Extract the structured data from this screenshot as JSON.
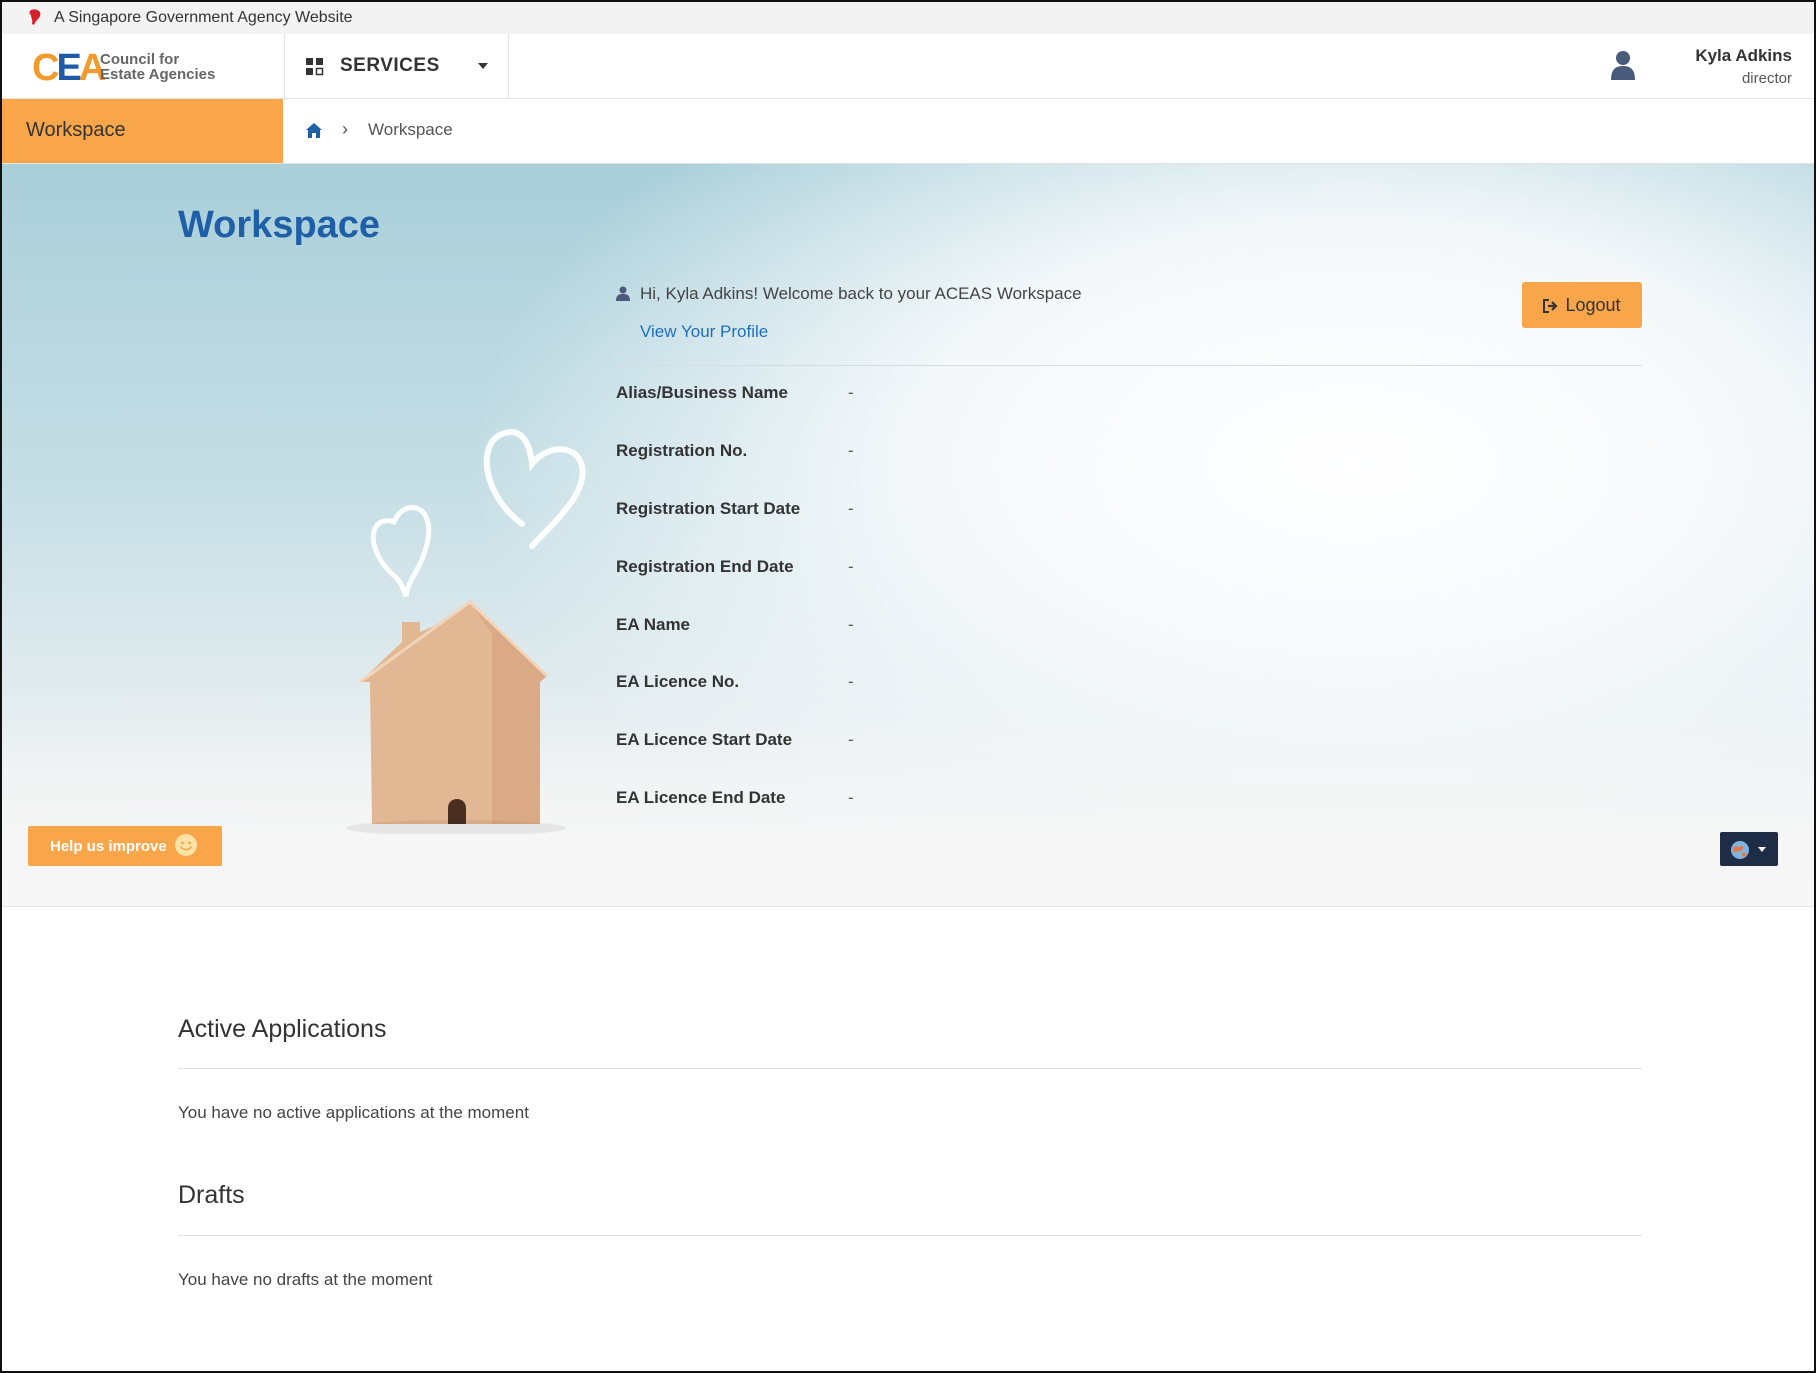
{
  "masthead": {
    "text": "A Singapore Government Agency Website"
  },
  "header": {
    "logo_mark_c": "C",
    "logo_mark_e": "E",
    "logo_mark_a": "A",
    "logo_line1": "Council for",
    "logo_line2": "Estate Agencies",
    "services_label": "SERVICES",
    "user_name": "Kyla Adkins",
    "user_role": "director"
  },
  "subnav": {
    "tab_label": "Workspace",
    "breadcrumb_sep": "›",
    "breadcrumb_current": "Workspace"
  },
  "hero": {
    "title": "Workspace",
    "welcome": "Hi, Kyla Adkins! Welcome back to your ACEAS Workspace",
    "profile_link": "View Your Profile",
    "logout_label": "Logout",
    "fields": [
      {
        "label": "Alias/Business Name",
        "value": "-"
      },
      {
        "label": "Registration No.",
        "value": "-"
      },
      {
        "label": "Registration Start Date",
        "value": "-"
      },
      {
        "label": "Registration End Date",
        "value": "-"
      },
      {
        "label": "EA Name",
        "value": "-"
      },
      {
        "label": "EA Licence No.",
        "value": "-"
      },
      {
        "label": "EA Licence Start Date",
        "value": "-"
      },
      {
        "label": "EA Licence End Date",
        "value": "-"
      }
    ],
    "help_label": "Help us improve"
  },
  "sections": {
    "active_title": "Active Applications",
    "active_text": "You have no active applications at the moment",
    "drafts_title": "Drafts",
    "drafts_text": "You have no drafts at the moment"
  },
  "colors": {
    "accent_orange": "#f9a64a",
    "title_blue": "#1f5fa8",
    "link_blue": "#1e6fc2",
    "lang_button": "#1e2d45"
  },
  "icons": [
    "lion-head-icon",
    "grid-icon",
    "chevron-down-icon",
    "user-icon",
    "home-icon",
    "logout-icon",
    "smile-icon",
    "globe-icon"
  ]
}
